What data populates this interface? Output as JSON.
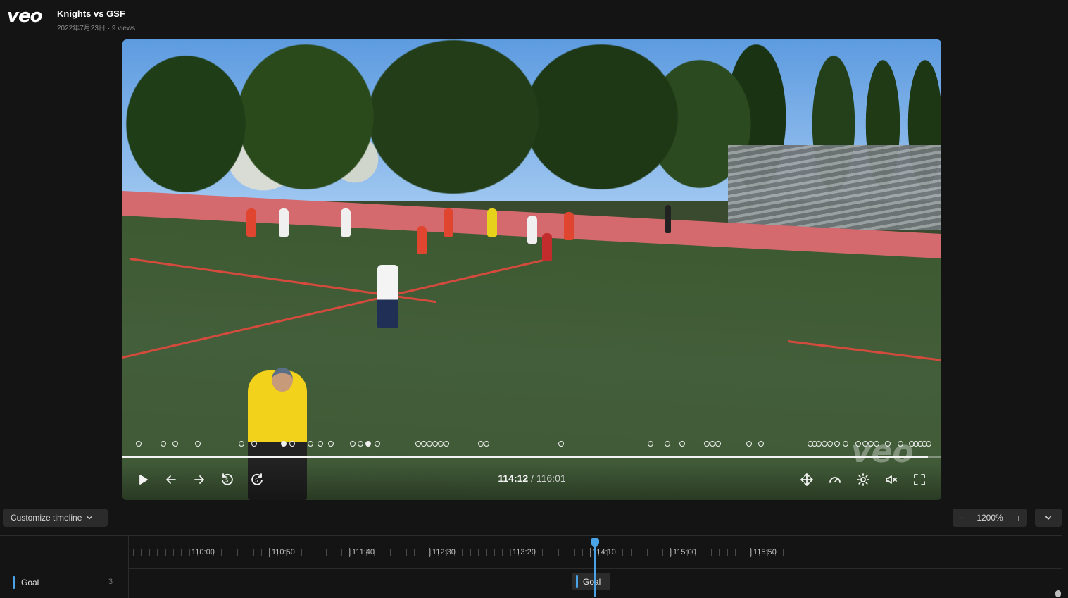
{
  "header": {
    "logo": "veo",
    "title": "Knights vs GSF",
    "meta": "2022年7月23日 · 9 views"
  },
  "player": {
    "current_time": "114:12",
    "total_time": " / 116:01",
    "watermark": "veo",
    "progress": 0.984
  },
  "toolbar": {
    "customize_label": "Customize timeline",
    "zoom_minus": "−",
    "zoom_level": "1200%",
    "zoom_plus": "+"
  },
  "timeline": {
    "ticks": [
      "110:00",
      "110:50",
      "111:40",
      "112:30",
      "113:20",
      "114:10",
      "115:00",
      "115:50"
    ],
    "rows": [
      {
        "label": "Goal",
        "count": "3"
      }
    ],
    "events": [
      {
        "label": "Goal"
      }
    ]
  },
  "colors": {
    "accent": "#4aa3e6",
    "background": "#141414",
    "button": "#2b2b2b"
  }
}
